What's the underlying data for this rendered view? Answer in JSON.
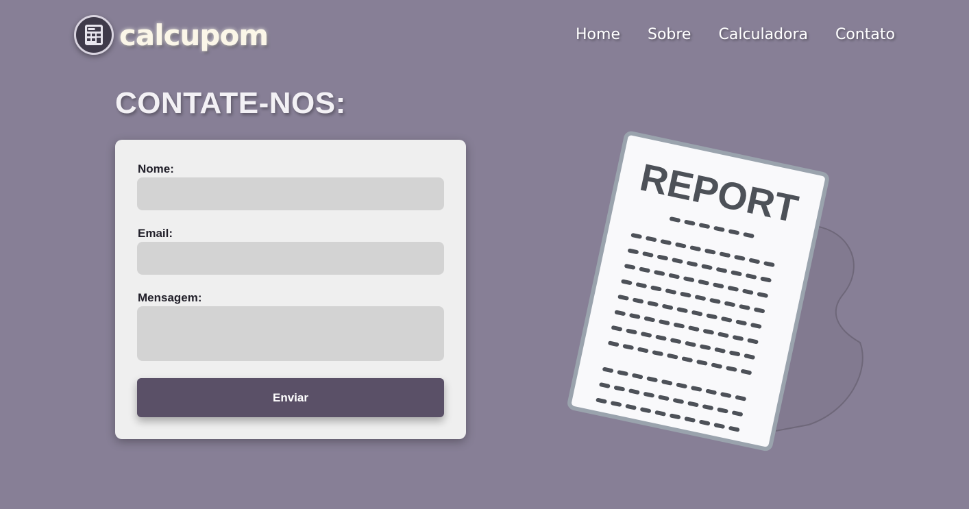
{
  "brand": {
    "name": "calcupom",
    "logo_icon": "calculator-icon"
  },
  "nav": {
    "items": [
      "Home",
      "Sobre",
      "Calculadora",
      "Contato"
    ]
  },
  "page": {
    "title": "CONTATE-NOS:"
  },
  "form": {
    "name_label": "Nome:",
    "email_label": "Email:",
    "message_label": "Mensagem:",
    "submit_label": "Enviar"
  },
  "illustration": {
    "text": "REPORT",
    "icon": "report-document-icon"
  },
  "colors": {
    "background": "#877f96",
    "card": "#efefef",
    "input": "#d3d3d3",
    "button": "#5a5067"
  }
}
